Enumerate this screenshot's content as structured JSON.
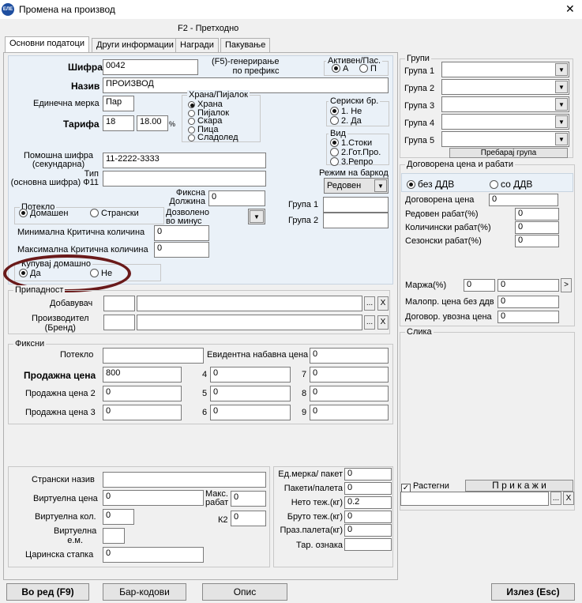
{
  "window": {
    "title": "Промена на производ",
    "close_glyph": "✕",
    "icon_text": "ЕЛЕ"
  },
  "hint": "F2 - Претходно",
  "tabs": [
    "Основни податоци",
    "Други информации",
    "Награди",
    "Пакување"
  ],
  "main": {
    "sifra_label": "Шифра",
    "sifra_value": "0042",
    "gen_hint": "(F5)-генерирање\nпо префикс",
    "aktiven_label": "Активен/Пас.",
    "aktiven_a": "А",
    "aktiven_p": "П",
    "naziv_label": "Назив",
    "naziv_value": "ПРОИЗВОД",
    "merka_label": "Единечна мерка",
    "merka_value": "Пар",
    "tarifa_label": "Тарифа",
    "tarifa_value": "18",
    "tarifa_pct": "18.00",
    "pct_sign": "%",
    "hrana_label": "Храна/Пијалок",
    "hrana_opts": [
      "Храна",
      "Пијалок",
      "Скара",
      "Пица",
      "Сладолед"
    ],
    "seriski_label": "Сериски бр.",
    "seriski_opts": [
      "1. Не",
      "2. Да"
    ],
    "vid_label": "Вид",
    "vid_opts": [
      "1.Стоки",
      "2.Гот.Про.",
      "3.Репро"
    ],
    "pomosna_label": "Помошна шифра\n(секундарна)",
    "pomosna_value": "11-2222-3333",
    "tip_label": "Тип\n(основна шифра) Ф11",
    "barkod_label": "Режим на баркод",
    "barkod_value": "Редовен",
    "poteklo_label": "Потекло",
    "poteklo_dom": "Домашен",
    "poteklo_str": "Странски",
    "fiksna_label": "Фиксна\nДолжина",
    "fiksna_value": "0",
    "dozvoleno_label": "Дозволено\nво минус",
    "grupa1_label": "Група 1",
    "grupa2_label": "Група 2",
    "min_label": "Минимална Критична количина",
    "min_value": "0",
    "max_label": "Максимална Критична количина",
    "max_value": "0",
    "kupuvaj_label": "Купувај домашно",
    "kupuvaj_da": "Да",
    "kupuvaj_ne": "Не"
  },
  "pripadnost": {
    "title": "Припадност",
    "dobavuvac": "Добавувач",
    "proizvoditel": "Производител\n(Бренд)",
    "dots": "...",
    "x": "X"
  },
  "fiksni": {
    "title": "Фиксни",
    "poteklo": "Потекло",
    "evid_label": "Евидентна набавна цена",
    "evid_value": "0",
    "prod_label": "Продажна цена",
    "prod_value": "800",
    "prod2_label": "Продажна цена 2",
    "prod2_value": "0",
    "prod3_label": "Продажна цена 3",
    "prod3_value": "0",
    "n4": "4",
    "n5": "5",
    "n6": "6",
    "n7": "7",
    "n8": "8",
    "n9": "9",
    "v4": "0",
    "v5": "0",
    "v6": "0",
    "v7": "0",
    "v8": "0",
    "v9": "0"
  },
  "bottom": {
    "stranski": "Странски назив",
    "virt_cena": "Виртуелна цена",
    "virt_cena_v": "0",
    "maks_rabat": "Макс.\nрабат",
    "maks_rabat_v": "0",
    "virt_kol": "Виртуелна кол.",
    "virt_kol_v": "0",
    "k2": "К2",
    "k2_v": "0",
    "virt_em": "Виртуелна\nе.м.",
    "carinska": "Царинска стапка",
    "carinska_v": "0"
  },
  "paket": {
    "ed_merka": "Ед.мерка/ пакет",
    "ed_merka_v": "0",
    "paketi": "Пакети/палета",
    "paketi_v": "0",
    "neto": "Нето теж.(кг)",
    "neto_v": "0.2",
    "bruto": "Бруто теж.(кг)",
    "bruto_v": "0",
    "praz": "Праз.палета(кг)",
    "praz_v": "0",
    "tar": "Тар. ознака"
  },
  "grupi": {
    "title": "Групи",
    "labels": [
      "Група 1",
      "Група 2",
      "Група 3",
      "Група 4",
      "Група 5"
    ],
    "search": "Пребарај група"
  },
  "dogovorena": {
    "title": "Договорена цена и рабати",
    "bez": "без ДДВ",
    "so": "со ДДВ",
    "cena": "Договорена цена",
    "cena_v": "0",
    "redoven": "Редовен рабат(%)",
    "redoven_v": "0",
    "kol": "Количински рабат(%)",
    "kol_v": "0",
    "sez": "Сезонски рабат(%)",
    "sez_v": "0",
    "marza": "Маржа(%)",
    "marza_v1": "0",
    "marza_v2": "0",
    "arrow": ">",
    "malopr": "Малопр. цена без ддв",
    "malopr_v": "0",
    "uvozna": "Договор. увозна цена",
    "uvozna_v": "0"
  },
  "slika": {
    "title": "Слика",
    "rastegni": "Растегни",
    "prikazi": "П р и к а ж и",
    "dots": "...",
    "x": "X"
  },
  "buttons": {
    "vored": "Во ред (F9)",
    "barkodovi": "Бар-кодови",
    "opis": "Опис",
    "izlez": "Излез (Esc)"
  },
  "colors": {
    "accent_circle": "#6a1a1a",
    "panel": "#eaf1f8"
  }
}
